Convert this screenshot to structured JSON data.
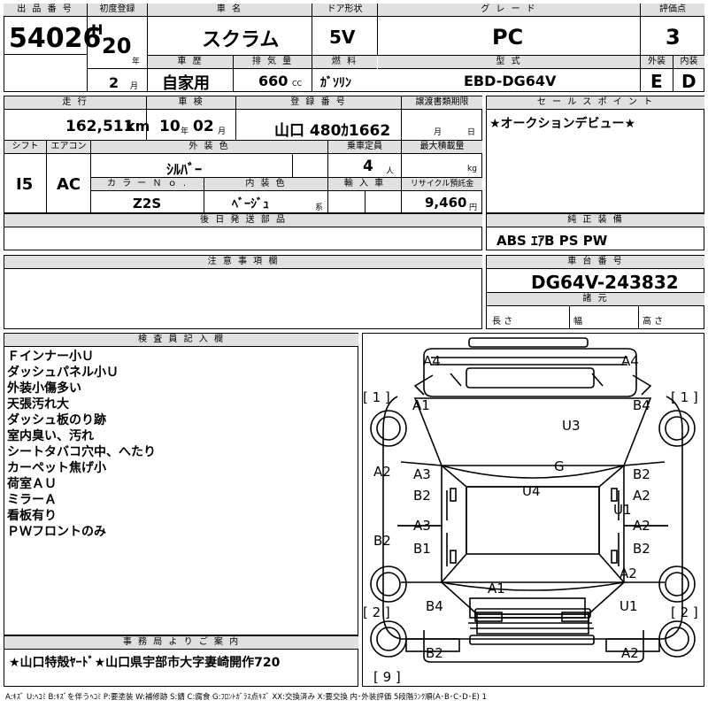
{
  "sheet": {
    "lot_label": "出 品 番 号",
    "lot_number": "54026",
    "first_reg_label": "初度登録",
    "era": "H",
    "year": "20",
    "year_unit": "年",
    "month": "2",
    "month_unit": "月",
    "car_name_label": "車 名",
    "car_name": "スクラム",
    "door_label": "ドア形状",
    "door": "5V",
    "grade_label": "グ レ ー ド",
    "grade": "PC",
    "score_label": "評価点",
    "score": "3",
    "history_label": "車 歴",
    "history": "自家用",
    "displacement_label": "排 気 量",
    "displacement": "660",
    "displacement_unit": "CC",
    "fuel_label": "燃 料",
    "fuel": "ｶﾞｿﾘﾝ",
    "model_label": "型 式",
    "model": "EBD-DG64V",
    "exterior_label": "外装",
    "exterior": "E",
    "interior_label": "内装",
    "interior": "D",
    "mileage_label": "走 行",
    "mileage": "162,511",
    "mileage_unit": "km",
    "inspection_label": "車 検",
    "inspection_year": "10",
    "inspection_year_unit": "年",
    "inspection_month": "02",
    "inspection_month_unit": "月",
    "reg_no_label": "登 録 番 号",
    "reg_no": "山口 480ｶ1662",
    "transfer_label": "譲渡書類期限",
    "transfer_month_unit": "月",
    "transfer_day_unit": "日",
    "sales_point_label": "セ ー ル ス ポ イ ン ト",
    "sales_point": "★オークションデビュー★",
    "shift_label": "シフト",
    "shift": "I5",
    "ac_label": "エアコン",
    "ac": "AC",
    "color_label": "外 装 色",
    "color": "ｼﾙﾊﾞｰ",
    "capacity_label": "乗車定員",
    "capacity": "4",
    "capacity_unit": "人",
    "load_label": "最大積載量",
    "load_unit": "kg",
    "color_no_label": "カ ラ ー Ｎ ｏ .",
    "color_no": "Z2S",
    "interior_color_label": "内 装 色",
    "interior_color": "ﾍﾞｰｼﾞｭ",
    "interior_color_unit": "系",
    "import_label": "輸 入 車",
    "recycle_label": "リサイクル預託金",
    "recycle": "9,460",
    "recycle_unit": "円",
    "later_parts_label": "後 日 発 送 部 品",
    "equipment_label": "純 正 装 備",
    "equipment": "ABS ｴｱB PS PW",
    "notes_label": "注 意 事 項 欄",
    "chassis_label": "車 台 番 号",
    "chassis": "DG64V-243832",
    "specs_label": "諸 元",
    "length_label": "長 さ",
    "width_label": "幅",
    "height_label": "高 さ",
    "inspector_label": "検 査 員 記 入 欄",
    "inspector_notes": [
      "Ｆインナー小Ｕ",
      "ダッシュパネル小Ｕ",
      "外装小傷多い",
      "天張汚れ大",
      "ダッシュ板のり跡",
      "室内臭い、汚れ",
      "シートタバコ穴中、へたり",
      "カーペット焦げ小",
      "荷室ＡＵ",
      "ミラーＡ",
      "看板有り",
      "ＰＷフロントのみ"
    ],
    "office_label": "事 務 局 よ り ご 案 内",
    "office_note": "★山口特殻ﾔｰﾄﾞ★山口県宇部市大字妻崎開作720",
    "legend": "A:ｷｽﾞ U:ﾍｺﾐ B:ｷｽﾞを伴うﾍｺﾐ P:要塗装 W:補修跡 S:錆 C:腐食 G:ﾌﾛﾝﾄｶﾞﾗｽ点ｷｽﾞ XX:交換済み X:要交換 内･外装評価 5段階ﾗﾝｸ順(A･B･C･D･E) 1"
  },
  "diagram": {
    "marks": [
      {
        "id": "a4-left",
        "text": "A4"
      },
      {
        "id": "a4-right",
        "text": "A4"
      },
      {
        "id": "bracket1-left",
        "text": "[ 1 ]"
      },
      {
        "id": "bracket1-right",
        "text": "[ 1 ]"
      },
      {
        "id": "a1-front-left",
        "text": "A1"
      },
      {
        "id": "b4-front-right",
        "text": "B4"
      },
      {
        "id": "u3",
        "text": "U3"
      },
      {
        "id": "g",
        "text": "G"
      },
      {
        "id": "a2-left-upper",
        "text": "A2"
      },
      {
        "id": "a3-upper",
        "text": "A3"
      },
      {
        "id": "b2-left-mid",
        "text": "B2"
      },
      {
        "id": "u4",
        "text": "U4"
      },
      {
        "id": "b2-right-upper",
        "text": "B2"
      },
      {
        "id": "a2-right-upper",
        "text": "A2"
      },
      {
        "id": "u1-right",
        "text": "U1"
      },
      {
        "id": "a3-lower",
        "text": "A3"
      },
      {
        "id": "b1-lower",
        "text": "B1"
      },
      {
        "id": "b2-left-lower",
        "text": "B2"
      },
      {
        "id": "a2-right-mid",
        "text": "A2"
      },
      {
        "id": "b2-right-lower",
        "text": "B2"
      },
      {
        "id": "a2-right-rear",
        "text": "A2"
      },
      {
        "id": "a1-rear",
        "text": "A1"
      },
      {
        "id": "b4-rear-left",
        "text": "B4"
      },
      {
        "id": "u1-rear-right",
        "text": "U1"
      },
      {
        "id": "bracket2-left",
        "text": "[ 2 ]"
      },
      {
        "id": "bracket2-right",
        "text": "[ 2 ]"
      },
      {
        "id": "b2-bottom-left",
        "text": "B2"
      },
      {
        "id": "a2-bottom-right",
        "text": "A2"
      },
      {
        "id": "bracket9",
        "text": "[ 9 ]"
      }
    ]
  }
}
